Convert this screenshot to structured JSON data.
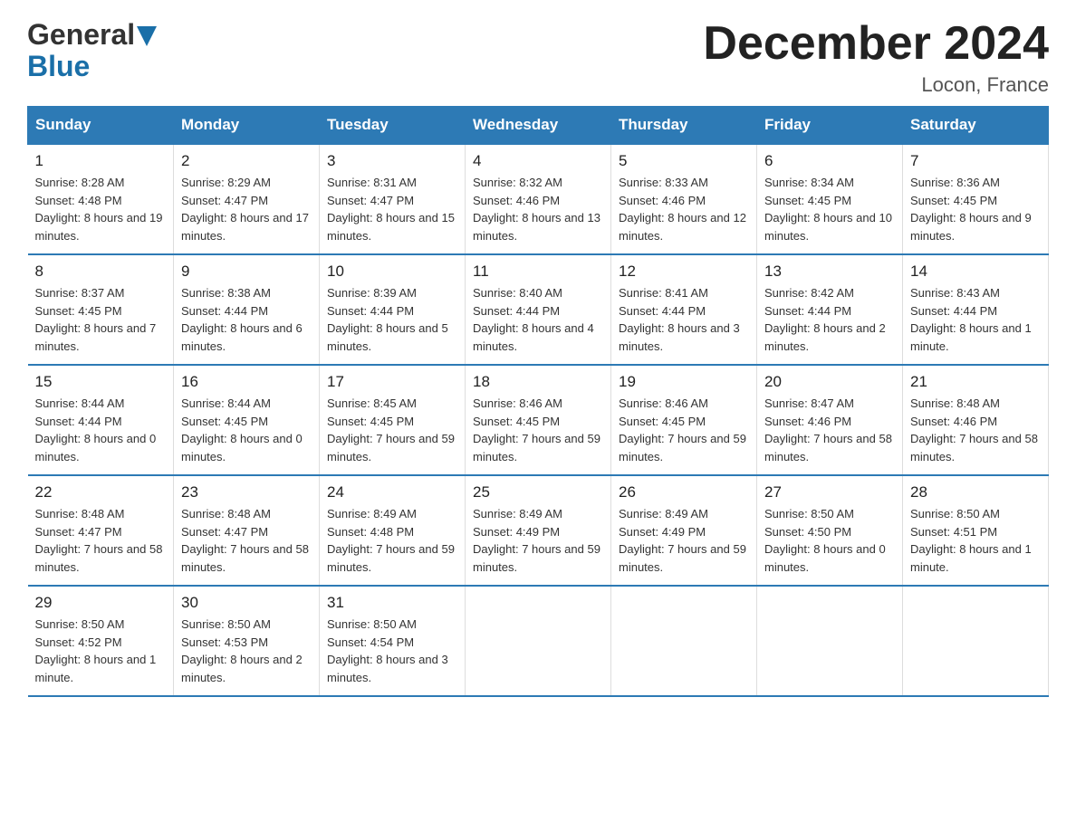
{
  "header": {
    "logo_general": "General",
    "logo_blue": "Blue",
    "month_title": "December 2024",
    "location": "Locon, France"
  },
  "calendar": {
    "days_of_week": [
      "Sunday",
      "Monday",
      "Tuesday",
      "Wednesday",
      "Thursday",
      "Friday",
      "Saturday"
    ],
    "weeks": [
      [
        {
          "day": "1",
          "sunrise": "8:28 AM",
          "sunset": "4:48 PM",
          "daylight": "8 hours and 19 minutes."
        },
        {
          "day": "2",
          "sunrise": "8:29 AM",
          "sunset": "4:47 PM",
          "daylight": "8 hours and 17 minutes."
        },
        {
          "day": "3",
          "sunrise": "8:31 AM",
          "sunset": "4:47 PM",
          "daylight": "8 hours and 15 minutes."
        },
        {
          "day": "4",
          "sunrise": "8:32 AM",
          "sunset": "4:46 PM",
          "daylight": "8 hours and 13 minutes."
        },
        {
          "day": "5",
          "sunrise": "8:33 AM",
          "sunset": "4:46 PM",
          "daylight": "8 hours and 12 minutes."
        },
        {
          "day": "6",
          "sunrise": "8:34 AM",
          "sunset": "4:45 PM",
          "daylight": "8 hours and 10 minutes."
        },
        {
          "day": "7",
          "sunrise": "8:36 AM",
          "sunset": "4:45 PM",
          "daylight": "8 hours and 9 minutes."
        }
      ],
      [
        {
          "day": "8",
          "sunrise": "8:37 AM",
          "sunset": "4:45 PM",
          "daylight": "8 hours and 7 minutes."
        },
        {
          "day": "9",
          "sunrise": "8:38 AM",
          "sunset": "4:44 PM",
          "daylight": "8 hours and 6 minutes."
        },
        {
          "day": "10",
          "sunrise": "8:39 AM",
          "sunset": "4:44 PM",
          "daylight": "8 hours and 5 minutes."
        },
        {
          "day": "11",
          "sunrise": "8:40 AM",
          "sunset": "4:44 PM",
          "daylight": "8 hours and 4 minutes."
        },
        {
          "day": "12",
          "sunrise": "8:41 AM",
          "sunset": "4:44 PM",
          "daylight": "8 hours and 3 minutes."
        },
        {
          "day": "13",
          "sunrise": "8:42 AM",
          "sunset": "4:44 PM",
          "daylight": "8 hours and 2 minutes."
        },
        {
          "day": "14",
          "sunrise": "8:43 AM",
          "sunset": "4:44 PM",
          "daylight": "8 hours and 1 minute."
        }
      ],
      [
        {
          "day": "15",
          "sunrise": "8:44 AM",
          "sunset": "4:44 PM",
          "daylight": "8 hours and 0 minutes."
        },
        {
          "day": "16",
          "sunrise": "8:44 AM",
          "sunset": "4:45 PM",
          "daylight": "8 hours and 0 minutes."
        },
        {
          "day": "17",
          "sunrise": "8:45 AM",
          "sunset": "4:45 PM",
          "daylight": "7 hours and 59 minutes."
        },
        {
          "day": "18",
          "sunrise": "8:46 AM",
          "sunset": "4:45 PM",
          "daylight": "7 hours and 59 minutes."
        },
        {
          "day": "19",
          "sunrise": "8:46 AM",
          "sunset": "4:45 PM",
          "daylight": "7 hours and 59 minutes."
        },
        {
          "day": "20",
          "sunrise": "8:47 AM",
          "sunset": "4:46 PM",
          "daylight": "7 hours and 58 minutes."
        },
        {
          "day": "21",
          "sunrise": "8:48 AM",
          "sunset": "4:46 PM",
          "daylight": "7 hours and 58 minutes."
        }
      ],
      [
        {
          "day": "22",
          "sunrise": "8:48 AM",
          "sunset": "4:47 PM",
          "daylight": "7 hours and 58 minutes."
        },
        {
          "day": "23",
          "sunrise": "8:48 AM",
          "sunset": "4:47 PM",
          "daylight": "7 hours and 58 minutes."
        },
        {
          "day": "24",
          "sunrise": "8:49 AM",
          "sunset": "4:48 PM",
          "daylight": "7 hours and 59 minutes."
        },
        {
          "day": "25",
          "sunrise": "8:49 AM",
          "sunset": "4:49 PM",
          "daylight": "7 hours and 59 minutes."
        },
        {
          "day": "26",
          "sunrise": "8:49 AM",
          "sunset": "4:49 PM",
          "daylight": "7 hours and 59 minutes."
        },
        {
          "day": "27",
          "sunrise": "8:50 AM",
          "sunset": "4:50 PM",
          "daylight": "8 hours and 0 minutes."
        },
        {
          "day": "28",
          "sunrise": "8:50 AM",
          "sunset": "4:51 PM",
          "daylight": "8 hours and 1 minute."
        }
      ],
      [
        {
          "day": "29",
          "sunrise": "8:50 AM",
          "sunset": "4:52 PM",
          "daylight": "8 hours and 1 minute."
        },
        {
          "day": "30",
          "sunrise": "8:50 AM",
          "sunset": "4:53 PM",
          "daylight": "8 hours and 2 minutes."
        },
        {
          "day": "31",
          "sunrise": "8:50 AM",
          "sunset": "4:54 PM",
          "daylight": "8 hours and 3 minutes."
        },
        null,
        null,
        null,
        null
      ]
    ]
  }
}
